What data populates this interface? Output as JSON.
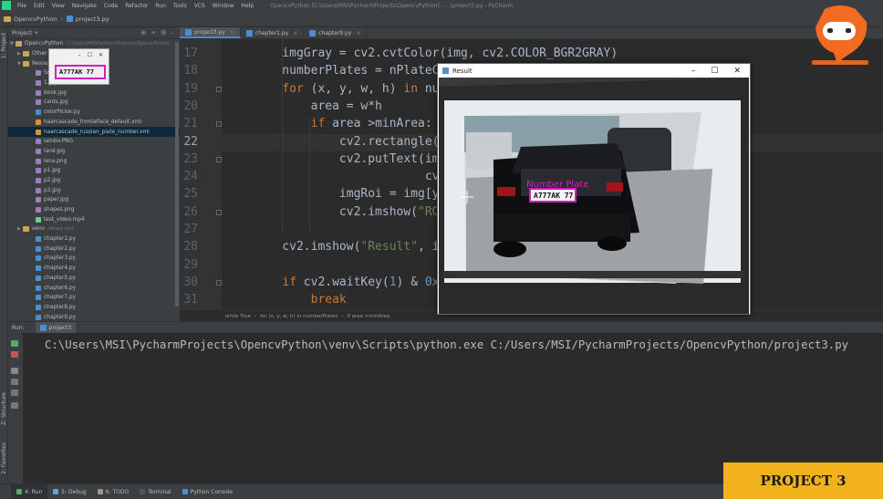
{
  "window": {
    "menu": [
      "File",
      "Edit",
      "View",
      "Navigate",
      "Code",
      "Refactor",
      "Run",
      "Tools",
      "VCS",
      "Window",
      "Help"
    ],
    "title": "OpencvPython [C:\\Users\\MSI\\PycharmProjects\\OpencvPython] - ...\\project3.py - PyCharm"
  },
  "navbar": {
    "project": "OpencvPython",
    "file": "project3.py"
  },
  "left_strip": {
    "project_tab": "1: Project",
    "structure_tab": "Z: Structure",
    "favorites_tab": "2: Favorites"
  },
  "project_panel": {
    "header": "Project",
    "tools": [
      "⊕",
      "÷",
      "⚙",
      "–"
    ],
    "tree": [
      {
        "label": "OpencvPython",
        "hint": "C:\\Users\\MSI\\PycharmProjects\\OpencvPython",
        "type": "folder",
        "arrow": "▼"
      },
      {
        "label": "Other",
        "type": "folder",
        "arrow": "▶"
      },
      {
        "label": "Resou",
        "type": "folder",
        "arrow": "▼"
      },
      {
        "label": "Sc",
        "type": "img",
        "arrow": ""
      },
      {
        "label": "1.jpg",
        "type": "img",
        "arrow": ""
      },
      {
        "label": "book.jpg",
        "type": "img",
        "arrow": ""
      },
      {
        "label": "cards.jpg",
        "type": "img",
        "arrow": ""
      },
      {
        "label": "colorPicker.py",
        "type": "py",
        "arrow": ""
      },
      {
        "label": "haarcascade_frontalface_default.xml",
        "type": "xml",
        "arrow": ""
      },
      {
        "label": "haarcascade_russian_plate_number.xml",
        "type": "xml",
        "arrow": "",
        "selected": true
      },
      {
        "label": "lambo.PNG",
        "type": "img",
        "arrow": ""
      },
      {
        "label": "land.jpg",
        "type": "img",
        "arrow": ""
      },
      {
        "label": "lena.png",
        "type": "img",
        "arrow": ""
      },
      {
        "label": "p1.jpg",
        "type": "img",
        "arrow": ""
      },
      {
        "label": "p2.jpg",
        "type": "img",
        "arrow": ""
      },
      {
        "label": "p3.jpg",
        "type": "img",
        "arrow": ""
      },
      {
        "label": "paper.jpg",
        "type": "img",
        "arrow": ""
      },
      {
        "label": "shapes.png",
        "type": "img",
        "arrow": ""
      },
      {
        "label": "test_video.mp4",
        "type": "mp4",
        "arrow": ""
      },
      {
        "label": "venv",
        "hint": "library root",
        "type": "folder",
        "arrow": "▶"
      },
      {
        "label": "chapter1.py",
        "type": "py",
        "arrow": ""
      },
      {
        "label": "chapter2.py",
        "type": "py",
        "arrow": ""
      },
      {
        "label": "chapter3.py",
        "type": "py",
        "arrow": ""
      },
      {
        "label": "chapter4.py",
        "type": "py",
        "arrow": ""
      },
      {
        "label": "chapter5.py",
        "type": "py",
        "arrow": ""
      },
      {
        "label": "chapter6.py",
        "type": "py",
        "arrow": ""
      },
      {
        "label": "chapter7.py",
        "type": "py",
        "arrow": ""
      },
      {
        "label": "chapter8.py",
        "type": "py",
        "arrow": ""
      },
      {
        "label": "chapter9.py",
        "type": "py",
        "arrow": ""
      }
    ]
  },
  "mini_window": {
    "plate": "A777AK 77"
  },
  "editor_tabs": [
    {
      "label": "project3.py",
      "active": true
    },
    {
      "label": "chapter1.py",
      "active": false
    },
    {
      "label": "chapter9.py",
      "active": false
    }
  ],
  "code": {
    "current_line": "22",
    "lines": [
      {
        "n": "17",
        "html": "    imgGray = cv2.cvtColor(img, cv2.COLOR_BGR2GRAY)"
      },
      {
        "n": "18",
        "html": "    numberPlates = nPlateCascade"
      },
      {
        "n": "19",
        "html": "    <span class=\"kw\">for</span> (x, y, w, h) <span class=\"kw\">in</span> numberPl"
      },
      {
        "n": "20",
        "html": "        area = w*h"
      },
      {
        "n": "21",
        "html": "        <span class=\"kw\">if</span> area &gt;minArea:"
      },
      {
        "n": "22",
        "html": "            cv2.rectangle(img, "
      },
      {
        "n": "23",
        "html": "            cv2.putText(img,<span class=\"str\">\"Nu</span>"
      },
      {
        "n": "24",
        "html": "                        cv2.FON"
      },
      {
        "n": "25",
        "html": "            imgRoi = img[y:y+h,"
      },
      {
        "n": "26",
        "html": "            cv2.imshow(<span class=\"str\">\"ROI\"</span>, i"
      },
      {
        "n": "27",
        "html": ""
      },
      {
        "n": "28",
        "html": "    cv2.imshow(<span class=\"str\">\"Result\"</span>, img)"
      },
      {
        "n": "29",
        "html": ""
      },
      {
        "n": "30",
        "html": "    <span class=\"kw\">if</span> cv2.waitKey(<span class=\"num\">1</span>) &amp; <span class=\"num\">0xFF</span> =="
      },
      {
        "n": "31",
        "html": "        <span class=\"kw\">break</span>"
      }
    ]
  },
  "breadcrumbs": [
    "while True",
    "›",
    "for (x, y, w, h) in numberPlates",
    "›",
    "if area >minArea"
  ],
  "run_panel": {
    "header": "Run:",
    "tab": "project3",
    "command": "C:\\Users\\MSI\\PycharmProjects\\OpencvPython\\venv\\Scripts\\python.exe C:/Users/MSI/PycharmProjects/OpencvPython/project3.py"
  },
  "bottom_tabs": [
    "4: Run",
    "5: Debug",
    "6: TODO",
    "Terminal",
    "Python Console"
  ],
  "result_window": {
    "title": "Result",
    "controls": [
      "–",
      "☐",
      "✕"
    ],
    "plate_label": "Number Plate",
    "plate_text": "A777AK 77"
  },
  "banner": {
    "text": "PROJECT 3"
  },
  "colors": {
    "accent": "#f2b21b",
    "plate_box": "#d020c0",
    "logo": "#f26b21"
  }
}
